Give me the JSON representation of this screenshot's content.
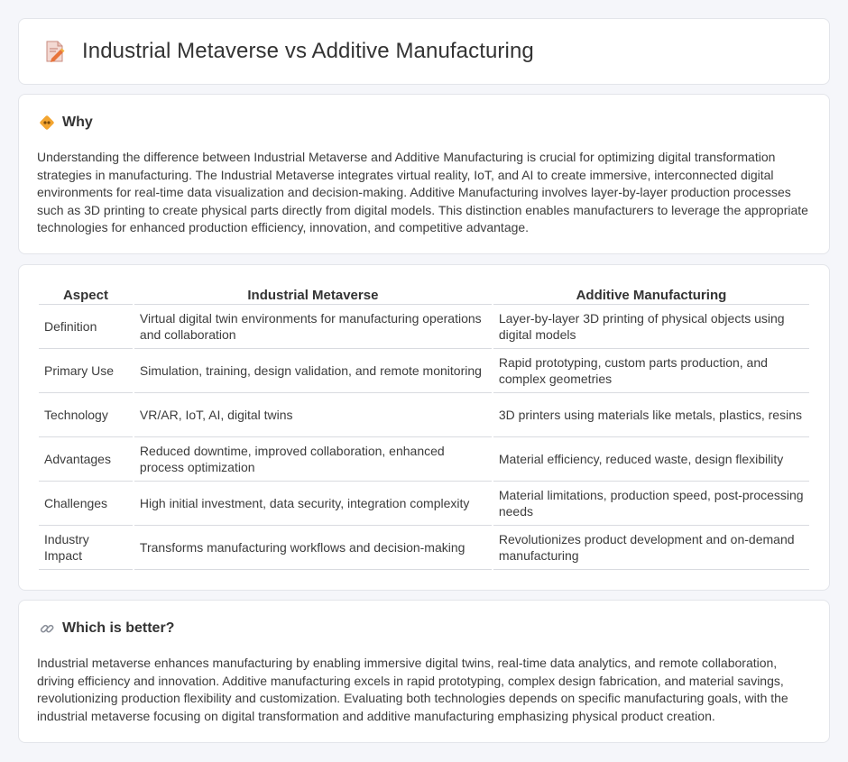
{
  "header": {
    "title": "Industrial Metaverse vs Additive Manufacturing",
    "icon": "document-edit-icon"
  },
  "why": {
    "title": "Why",
    "icon": "diamond-sign-icon",
    "text": "Understanding the difference between Industrial Metaverse and Additive Manufacturing is crucial for optimizing digital transformation strategies in manufacturing. The Industrial Metaverse integrates virtual reality, IoT, and AI to create immersive, interconnected digital environments for real-time data visualization and decision-making. Additive Manufacturing involves layer-by-layer production processes such as 3D printing to create physical parts directly from digital models. This distinction enables manufacturers to leverage the appropriate technologies for enhanced production efficiency, innovation, and competitive advantage."
  },
  "table": {
    "headers": [
      "Aspect",
      "Industrial Metaverse",
      "Additive Manufacturing"
    ],
    "rows": [
      [
        "Definition",
        "Virtual digital twin environments for manufacturing operations and collaboration",
        "Layer-by-layer 3D printing of physical objects using digital models"
      ],
      [
        "Primary Use",
        "Simulation, training, design validation, and remote monitoring",
        "Rapid prototyping, custom parts production, and complex geometries"
      ],
      [
        "Technology",
        "VR/AR, IoT, AI, digital twins",
        "3D printers using materials like metals, plastics, resins"
      ],
      [
        "Advantages",
        "Reduced downtime, improved collaboration, enhanced process optimization",
        "Material efficiency, reduced waste, design flexibility"
      ],
      [
        "Challenges",
        "High initial investment, data security, integration complexity",
        "Material limitations, production speed, post-processing needs"
      ],
      [
        "Industry Impact",
        "Transforms manufacturing workflows and decision-making",
        "Revolutionizes product development and on-demand manufacturing"
      ]
    ]
  },
  "better": {
    "title": "Which is better?",
    "icon": "link-icon",
    "text": "Industrial metaverse enhances manufacturing by enabling immersive digital twins, real-time data analytics, and remote collaboration, driving efficiency and innovation. Additive manufacturing excels in rapid prototyping, complex design fabrication, and material savings, revolutionizing production flexibility and customization. Evaluating both technologies depends on specific manufacturing goals, with the industrial metaverse focusing on digital transformation and additive manufacturing emphasizing physical product creation."
  }
}
